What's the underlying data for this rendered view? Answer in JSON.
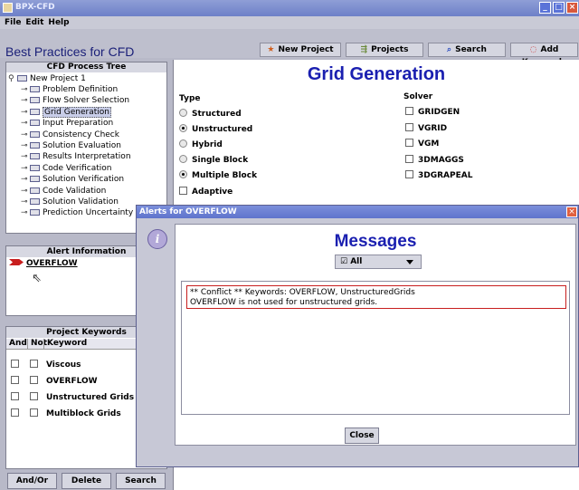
{
  "window": {
    "title": "BPX-CFD"
  },
  "menu": {
    "file": "File",
    "edit": "Edit",
    "help": "Help"
  },
  "app": {
    "title": "Best Practices for CFD"
  },
  "toolbar": {
    "new_project": "New Project",
    "projects": "Projects",
    "search": "Search",
    "add_keywords": "Add Keywords"
  },
  "tree": {
    "header": "CFD Process Tree",
    "root": "New Project 1",
    "items": [
      "Problem Definition",
      "Flow Solver Selection",
      "Grid Generation",
      "Input Preparation",
      "Consistency Check",
      "Solution Evaluation",
      "Results Interpretation",
      "Code Verification",
      "Solution Verification",
      "Code Validation",
      "Solution Validation",
      "Prediction Uncertainty"
    ],
    "selected": "Grid Generation"
  },
  "alerts": {
    "header": "Alert Information",
    "items": [
      "OVERFLOW"
    ]
  },
  "keywords": {
    "header": "Project Keywords",
    "col_and": "And",
    "col_not": "Not",
    "col_keyword": "Keyword",
    "rows": [
      "Viscous",
      "OVERFLOW",
      "Unstructured Grids",
      "Multiblock Grids"
    ]
  },
  "bottom_buttons": {
    "andor": "And/Or",
    "delete": "Delete",
    "search": "Search"
  },
  "main": {
    "title": "Grid Generation",
    "type_label": "Type",
    "types": [
      {
        "label": "Structured",
        "selected": false
      },
      {
        "label": "Unstructured",
        "selected": true
      },
      {
        "label": "Hybrid",
        "selected": false
      },
      {
        "label": "Single Block",
        "selected": false
      },
      {
        "label": "Multiple Block",
        "selected": true
      }
    ],
    "adaptive": "Adaptive",
    "solver_label": "Solver",
    "solvers": [
      "GRIDGEN",
      "VGRID",
      "VGM",
      "3DMAGGS",
      "3DGRAPEAL"
    ]
  },
  "dialog": {
    "title": "Alerts for OVERFLOW",
    "heading": "Messages",
    "filter": "All",
    "message_line1": "** Conflict ** Keywords: OVERFLOW, UnstructuredGrids",
    "message_line2": "OVERFLOW is not used for unstructured grids.",
    "close": "Close"
  },
  "colors": {
    "title_blue": "#1a1fb0",
    "alert_red": "#c81e1e",
    "titlebar": "#6d80c8"
  }
}
